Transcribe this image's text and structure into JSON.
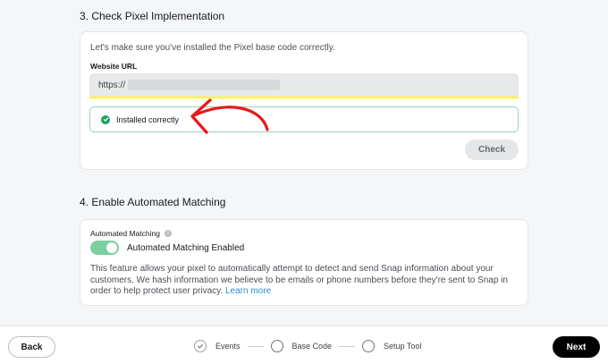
{
  "section3": {
    "title": "3. Check Pixel Implementation",
    "intro": "Let's make sure you've installed the Pixel base code correctly.",
    "url_label": "Website URL",
    "url_value": "https://",
    "status": "Installed correctly",
    "check_button": "Check"
  },
  "section4": {
    "title": "4. Enable Automated Matching",
    "label": "Automated Matching",
    "info_glyph": "i",
    "toggle_on": true,
    "toggle_label": "Automated Matching Enabled",
    "description": "This feature allows your pixel to automatically attempt to detect and send Snap information about your customers. We hash information we believe to be emails or phone numbers before they're sent to Snap in order to help protect user privacy.",
    "learn_more": "Learn more"
  },
  "footer": {
    "back": "Back",
    "next": "Next",
    "steps": [
      {
        "label": "Events",
        "state": "done"
      },
      {
        "label": "Base Code",
        "state": "current"
      },
      {
        "label": "Setup Tool",
        "state": "pending"
      }
    ]
  },
  "colors": {
    "accent_yellow": "#fffc00",
    "success_green": "#1e9e5b",
    "toggle_green": "#7ccea0",
    "link_blue": "#2c8fd6",
    "annotation_red": "#e8191c"
  }
}
